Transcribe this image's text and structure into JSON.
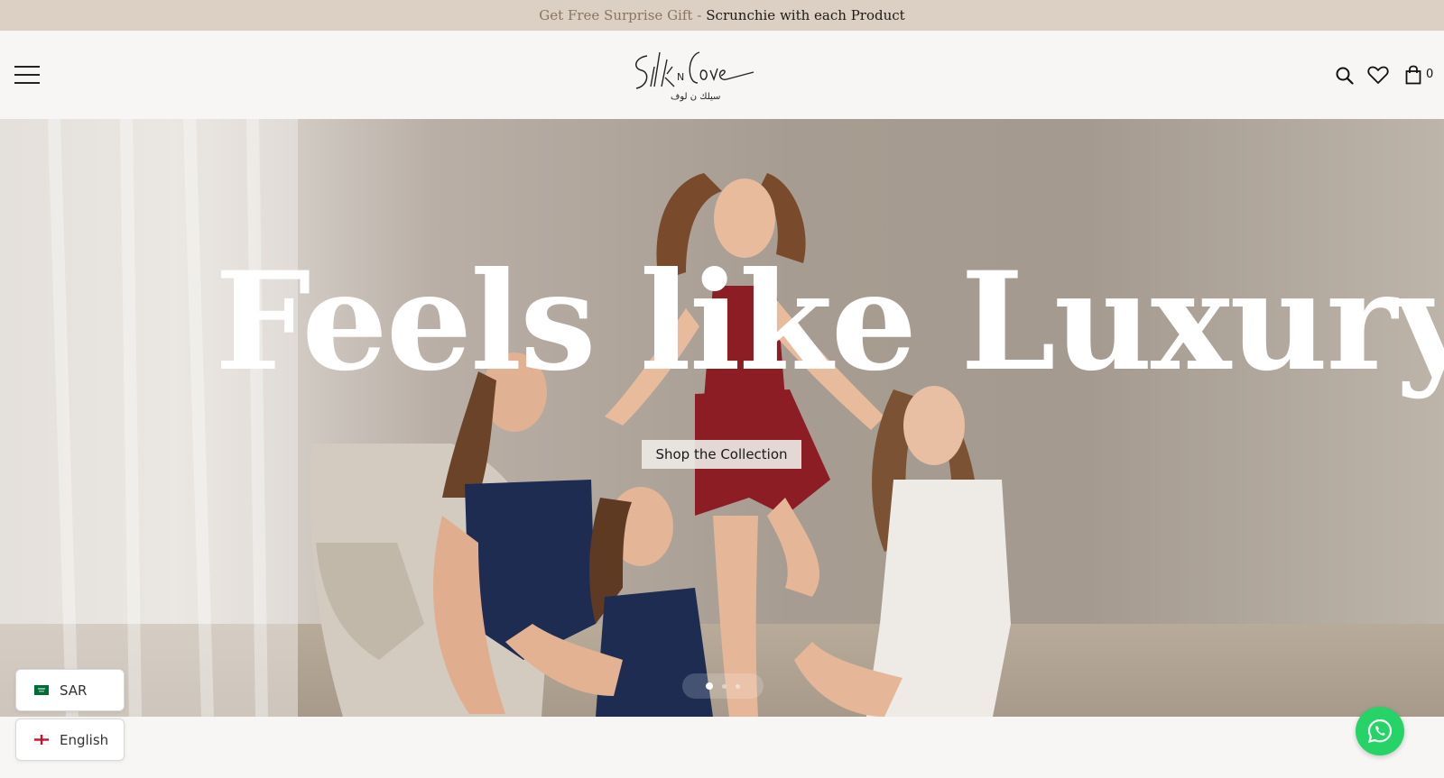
{
  "announcement": {
    "prefix": "Get Free Surprise Gift -",
    "highlight": "Scrunchie with each Product"
  },
  "header": {
    "menu_icon": "hamburger-menu-icon",
    "logo": {
      "text": "SilkNLove",
      "arabic_text": "سيلك ن لوف"
    },
    "search_icon": "search-icon",
    "wishlist_icon": "heart-icon",
    "cart_icon": "shopping-bag-icon",
    "cart_count": "0"
  },
  "hero": {
    "headline": "Feels like Luxury",
    "cta_label": "Shop the Collection",
    "slides": [
      {
        "active": true
      },
      {
        "active": false
      },
      {
        "active": false
      }
    ]
  },
  "pickers": {
    "currency": {
      "label": "SAR",
      "flag": "saudi-arabia-flag-icon"
    },
    "language": {
      "label": "English",
      "flag": "uk-flag-icon"
    }
  },
  "chat": {
    "icon": "whatsapp-icon"
  },
  "colors": {
    "announcement_bg": "#dbd0c3",
    "whatsapp": "#25d366",
    "garment_navy": "#1e2c52",
    "garment_red": "#8c1d24",
    "garment_ivory": "#eeeae6"
  }
}
